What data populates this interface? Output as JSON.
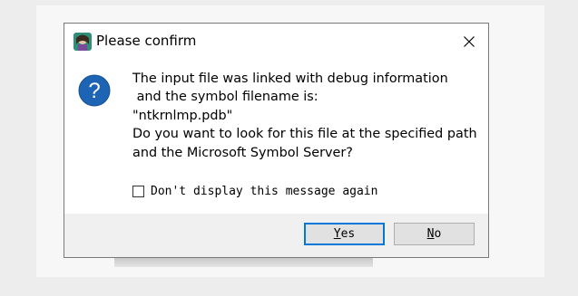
{
  "dialog": {
    "title": "Please confirm",
    "message_lines": [
      "The input file was linked with debug information",
      " and the symbol filename is:",
      "\"ntkrnlmp.pdb\"",
      "Do you want to look for this file at the specified path",
      "and the Microsoft Symbol Server?"
    ],
    "checkbox": {
      "label": "Don't display this message again",
      "checked": false
    },
    "buttons": {
      "yes": {
        "mnemonic": "Y",
        "rest": "es"
      },
      "no": {
        "mnemonic": "N",
        "rest": "o"
      }
    }
  },
  "colors": {
    "accent": "#0078d7",
    "question_icon": "#1e64b4",
    "window_bg": "#f0f0f0"
  },
  "icons": [
    "app-icon",
    "close-icon",
    "question-icon"
  ]
}
